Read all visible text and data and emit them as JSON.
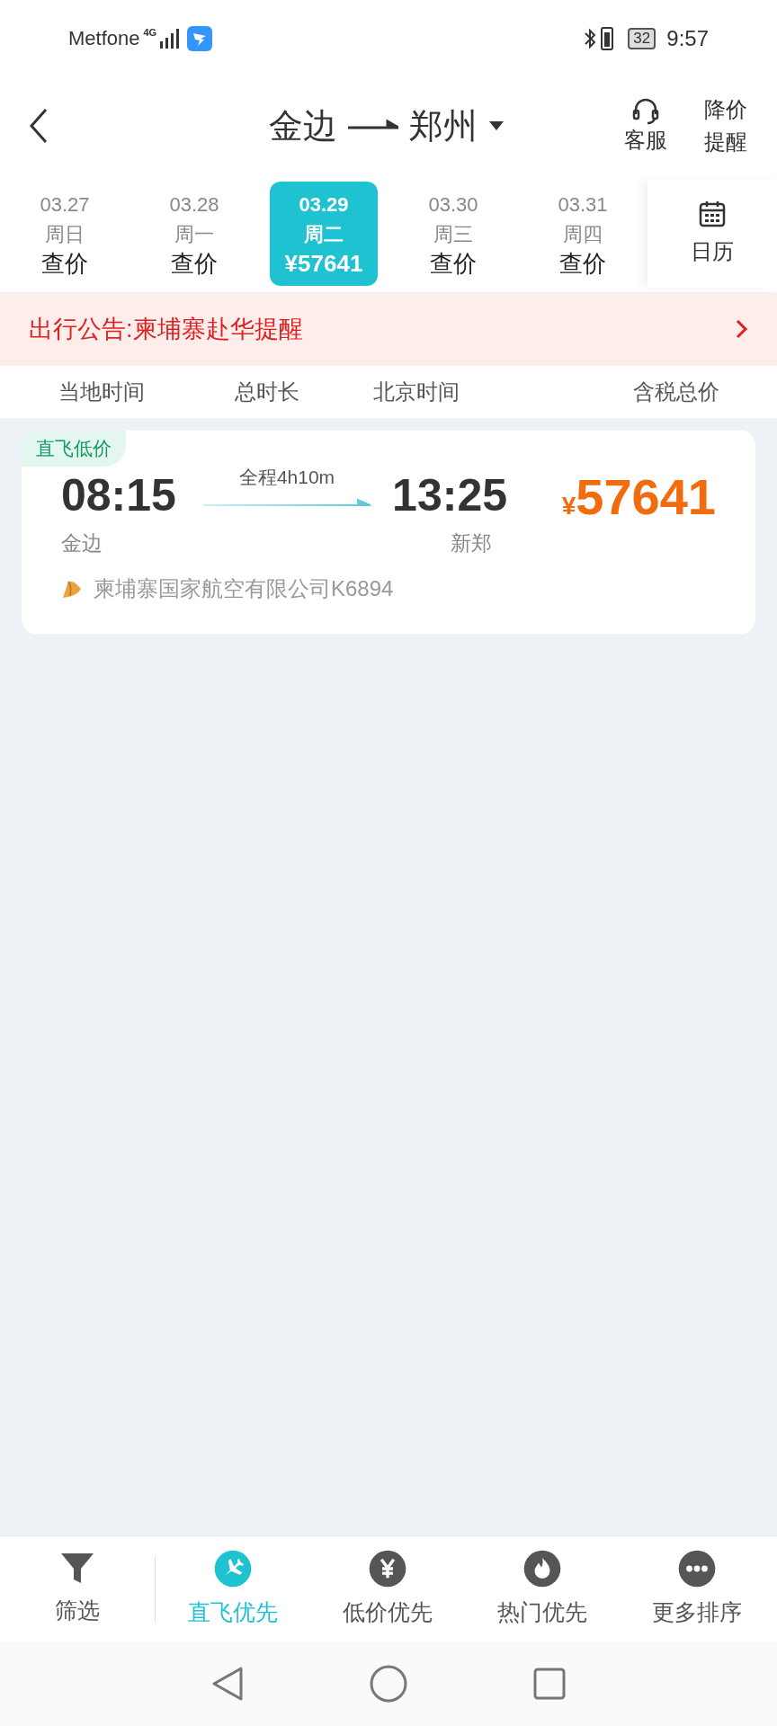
{
  "status_bar": {
    "carrier": "Metfone",
    "network": "4G",
    "battery": "32",
    "time": "9:57"
  },
  "header": {
    "origin": "金边",
    "destination": "郑州",
    "actions": [
      {
        "kind": "headset",
        "label": "客服"
      },
      {
        "kind": "text",
        "label": "降价提醒"
      }
    ]
  },
  "dates": [
    {
      "date": "03.27",
      "weekday": "周日",
      "price": "查价",
      "selected": false
    },
    {
      "date": "03.28",
      "weekday": "周一",
      "price": "查价",
      "selected": false
    },
    {
      "date": "03.29",
      "weekday": "周二",
      "price": "¥57641",
      "selected": true
    },
    {
      "date": "03.30",
      "weekday": "周三",
      "price": "查价",
      "selected": false
    },
    {
      "date": "03.31",
      "weekday": "周四",
      "price": "查价",
      "selected": false
    }
  ],
  "calendar_button": "日历",
  "notice": "出行公告:柬埔寨赴华提醒",
  "columns": [
    "当地时间",
    "总时长",
    "北京时间",
    "含税总价"
  ],
  "flights": [
    {
      "tag": "直飞低价",
      "depart_time": "08:15",
      "depart_airport": "金边",
      "duration": "全程4h10m",
      "arrive_time": "13:25",
      "arrive_airport": "新郑",
      "currency": "¥",
      "price": "57641",
      "airline": "柬埔寨国家航空有限公司K6894"
    }
  ],
  "bottom_bar": {
    "filter": "筛选",
    "sorts": [
      {
        "kind": "plane",
        "label": "直飞优先",
        "selected": true
      },
      {
        "kind": "yen",
        "label": "低价优先",
        "selected": false
      },
      {
        "kind": "fire",
        "label": "热门优先",
        "selected": false
      },
      {
        "kind": "more",
        "label": "更多排序",
        "selected": false
      }
    ]
  }
}
